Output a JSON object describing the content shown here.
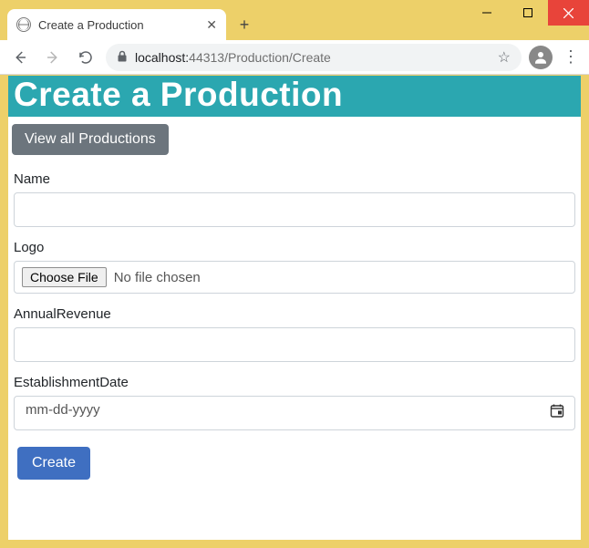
{
  "window": {
    "tab_title": "Create a Production"
  },
  "address": {
    "host": "localhost:",
    "port": "44313",
    "path": "/Production/Create"
  },
  "page": {
    "heading": "Create a Production",
    "view_all_label": "View all Productions"
  },
  "form": {
    "name": {
      "label": "Name",
      "value": ""
    },
    "logo": {
      "label": "Logo",
      "choose_button": "Choose File",
      "status": "No file chosen"
    },
    "annual_revenue": {
      "label": "AnnualRevenue",
      "value": ""
    },
    "establishment_date": {
      "label": "EstablishmentDate",
      "placeholder": "mm-dd-yyyy"
    },
    "submit_label": "Create"
  }
}
